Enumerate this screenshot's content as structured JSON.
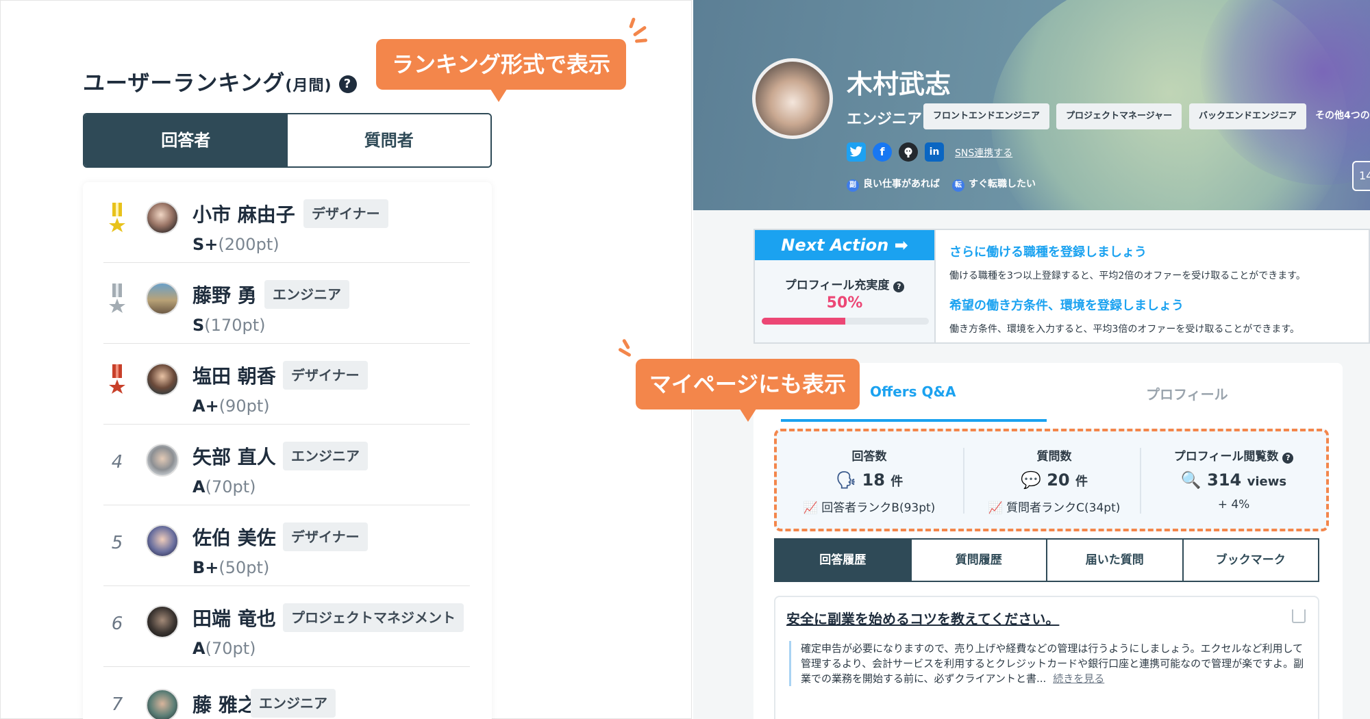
{
  "ranking": {
    "title": "ユーザーランキング",
    "period": "(月間)",
    "help": "?",
    "callout": "ランキング形式で表示",
    "tabs": [
      "回答者",
      "質問者"
    ],
    "items": [
      {
        "rank": "1",
        "name": "小市 麻由子",
        "role": "デザイナー",
        "grade": "S+",
        "points": "(200pt)",
        "medal": "gold"
      },
      {
        "rank": "2",
        "name": "藤野 勇",
        "role": "エンジニア",
        "grade": "S",
        "points": "(170pt)",
        "medal": "silver"
      },
      {
        "rank": "3",
        "name": "塩田 朝香",
        "role": "デザイナー",
        "grade": "A+",
        "points": "(90pt)",
        "medal": "bronze"
      },
      {
        "rank": "4",
        "name": "矢部 直人",
        "role": "エンジニア",
        "grade": "A",
        "points": "(70pt)"
      },
      {
        "rank": "5",
        "name": "佐伯 美佐",
        "role": "デザイナー",
        "grade": "B+",
        "points": "(50pt)"
      },
      {
        "rank": "6",
        "name": "田端 竜也",
        "role": "プロジェクトマネジメント",
        "grade": "A",
        "points": "(70pt)"
      },
      {
        "rank": "7",
        "name": "藤 雅之",
        "role": "エンジニア",
        "grade": "",
        "points": ""
      }
    ]
  },
  "mypage": {
    "callout": "マイページにも表示",
    "profile": {
      "name": "木村武志",
      "role": "エンジニア",
      "tags": [
        "フロントエンドエンジニア",
        "プロジェクトマネージャー",
        "バックエンドエンジニア"
      ],
      "more": "その他4つの",
      "sns_link": "SNS連携する",
      "sns_icons": [
        "twitter-icon",
        "facebook-icon",
        "github-icon",
        "linkedin-icon"
      ],
      "wish1_icon": "副",
      "wish1": "良い仕事があれば",
      "wish2_icon": "転",
      "wish2": "すぐ転職したい",
      "edge": "14"
    },
    "next_action": {
      "header": "Next Action ➡",
      "fill_label": "プロフィール充実度",
      "fill_pct": "50%",
      "fill_value": 0.5,
      "items": [
        {
          "link": "さらに働ける職種を登録しましょう",
          "desc": "働ける職種を3つ以上登録すると、平均2倍のオファーを受け取ることができます。"
        },
        {
          "link": "希望の働き方条件、環境を登録しましょう",
          "desc": "働き方条件、環境を入力すると、平均3倍のオファーを受け取ることができます。"
        }
      ]
    },
    "tabs": [
      "Offers Q&A",
      "プロフィール"
    ],
    "stats": [
      {
        "label": "回答数",
        "icon": "speaking-icon",
        "value": "18",
        "unit": "件",
        "sub": "回答者ランクB(93pt)"
      },
      {
        "label": "質問数",
        "icon": "speech-bubble-icon",
        "value": "20",
        "unit": "件",
        "sub": "質問者ランクC(34pt)"
      },
      {
        "label": "プロフィール閲覧数",
        "icon": "magnifier-icon",
        "value": "314",
        "unit": "views",
        "sub": "+ 4%"
      }
    ],
    "history_tabs": [
      "回答履歴",
      "質問履歴",
      "届いた質問",
      "ブックマーク"
    ],
    "question": {
      "title": "安全に副業を始めるコツを教えてください。",
      "body": "確定申告が必要になりますので、売り上げや経費などの管理は行うようにしましょう。エクセルなど利用して管理するより、会計サービスを利用するとクレジットカードや銀行口座と連携可能なので管理が楽ですよ。副業での業務を開始する前に、必ずクライアントと書...",
      "more": "続きを見る"
    }
  },
  "colors": {
    "navy": "#2f4a57",
    "orange": "#f3864b",
    "blue": "#1ba2f0",
    "pink": "#ec4775"
  }
}
